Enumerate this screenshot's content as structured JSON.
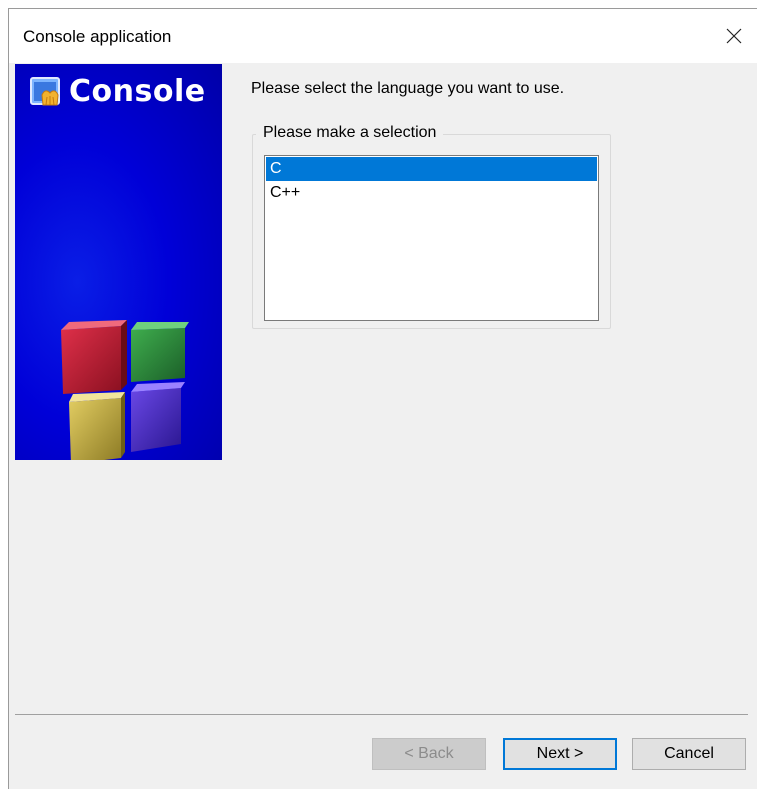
{
  "window": {
    "title": "Console application",
    "close_icon": "close-icon"
  },
  "banner": {
    "title": "Console",
    "icon": "console-app-icon",
    "background_color": "#0000d8",
    "cube_colors": [
      "#c41a2e",
      "#2e8b3a",
      "#c7b040",
      "#4a2ec0"
    ]
  },
  "main": {
    "prompt": "Please select the language you want to use.",
    "group_label": "Please make a selection",
    "languages": [
      {
        "label": "C",
        "selected": true
      },
      {
        "label": "C++",
        "selected": false
      }
    ],
    "selection_color": "#0078d7"
  },
  "footer": {
    "back_label": "< Back",
    "back_enabled": false,
    "next_label": "Next >",
    "cancel_label": "Cancel"
  }
}
